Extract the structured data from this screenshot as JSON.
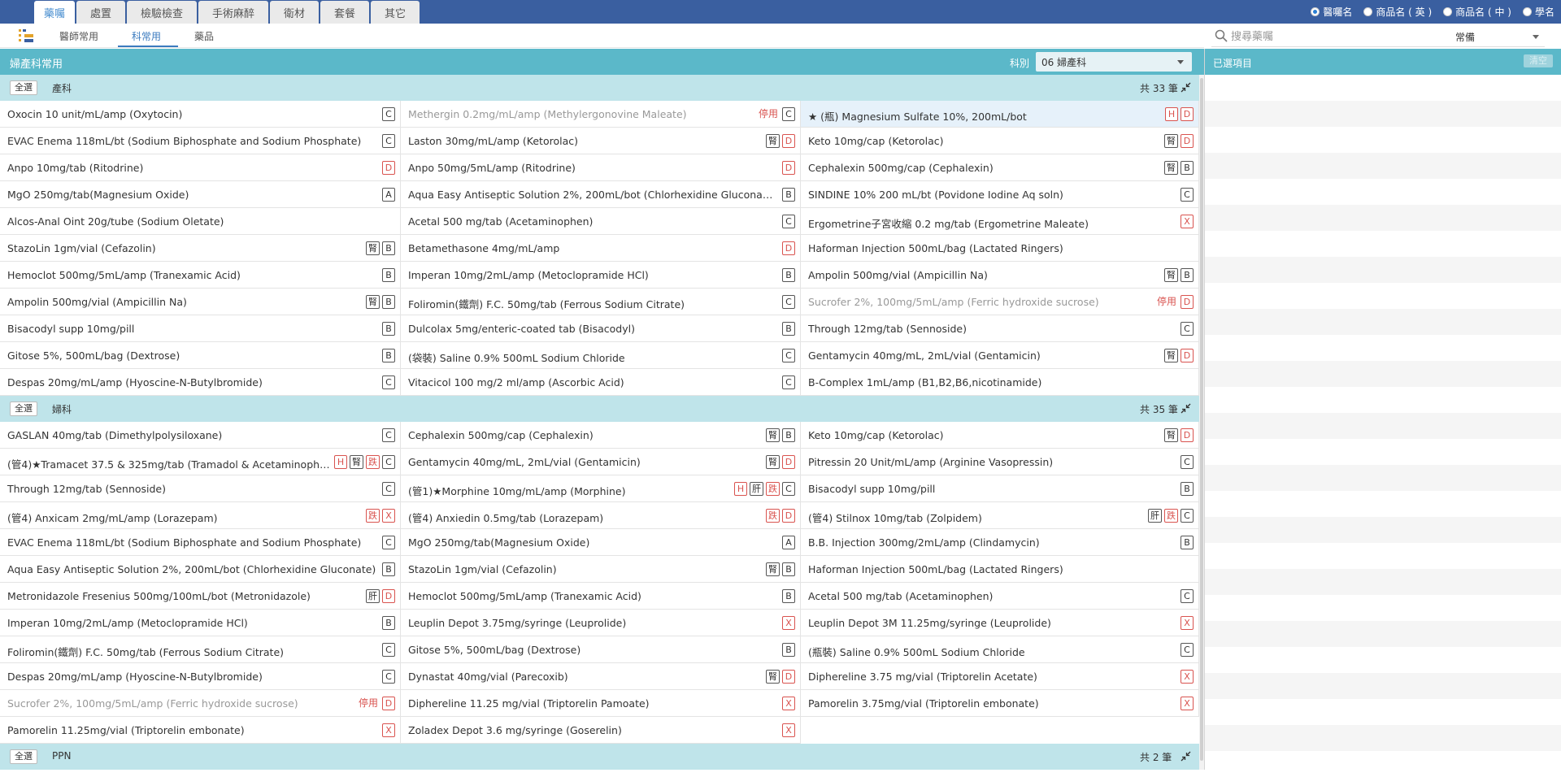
{
  "tabs": [
    {
      "label": "藥囑",
      "active": true
    },
    {
      "label": "處置",
      "active": false
    },
    {
      "label": "檢驗檢查",
      "active": false
    },
    {
      "label": "手術麻醉",
      "active": false
    },
    {
      "label": "衛材",
      "active": false
    },
    {
      "label": "套餐",
      "active": false
    },
    {
      "label": "其它",
      "active": false
    }
  ],
  "name_options": [
    {
      "label": "醫囑名",
      "selected": true
    },
    {
      "label": "商品名 ( 英 )",
      "selected": false
    },
    {
      "label": "商品名 ( 中 )",
      "selected": false
    },
    {
      "label": "學名",
      "selected": false
    }
  ],
  "subtabs": [
    {
      "label": "醫師常用",
      "active": false
    },
    {
      "label": "科常用",
      "active": true
    },
    {
      "label": "藥品",
      "active": false
    }
  ],
  "search": {
    "placeholder": "搜尋藥囑",
    "category": "常備"
  },
  "panel": {
    "title": "婦產科常用",
    "dept_label": "科別",
    "dept_value": "06 婦產科"
  },
  "right_panel": {
    "title": "已選項目",
    "clear_label": "清空"
  },
  "colors": {
    "header": "#5bb8c9",
    "group_header": "#bfe4ea",
    "topbar": "#3a5fa0",
    "badge_red": "#d9534f",
    "accent": "#3b7bbf"
  },
  "groups": [
    {
      "select_all": "全選",
      "name": "產科",
      "count": "共 33 筆",
      "items": [
        {
          "name": "Oxocin 10 unit/mL/amp (Oxytocin)",
          "badges": [
            "C"
          ]
        },
        {
          "name": "Methergin 0.2mg/mL/amp (Methylergonovine Maleate)",
          "disabled": true,
          "stop": "停用",
          "badges": [
            "C"
          ]
        },
        {
          "name": "★ (瓶) Magnesium Sulfate 10%, 200mL/bot",
          "highlight": true,
          "badges": [
            "H",
            "D"
          ]
        },
        {
          "name": "EVAC Enema 118mL/bt (Sodium Biphosphate and Sodium Phosphate)",
          "badges": [
            "C"
          ]
        },
        {
          "name": "Laston 30mg/mL/amp (Ketorolac)",
          "badges": [
            "腎",
            "D"
          ]
        },
        {
          "name": "Keto 10mg/cap (Ketorolac)",
          "badges": [
            "腎",
            "D"
          ]
        },
        {
          "name": "Anpo 10mg/tab (Ritodrine)",
          "badges": [
            "D"
          ]
        },
        {
          "name": "Anpo 50mg/5mL/amp (Ritodrine)",
          "badges": [
            "D"
          ]
        },
        {
          "name": "Cephalexin 500mg/cap (Cephalexin)",
          "badges": [
            "腎",
            "B"
          ]
        },
        {
          "name": "MgO 250mg/tab(Magnesium Oxide)",
          "badges": [
            "A"
          ]
        },
        {
          "name": "Aqua Easy Antiseptic Solution 2%, 200mL/bot (Chlorhexidine Gluconate)",
          "badges": [
            "B"
          ]
        },
        {
          "name": "SINDINE 10% 200 mL/bt (Povidone Iodine Aq soln)",
          "badges": [
            "C"
          ]
        },
        {
          "name": "Alcos-Anal Oint 20g/tube (Sodium Oletate)",
          "badges": []
        },
        {
          "name": "Acetal 500 mg/tab (Acetaminophen)",
          "badges": [
            "C"
          ]
        },
        {
          "name": "Ergometrine子宮收縮 0.2 mg/tab (Ergometrine Maleate)",
          "badges": [
            "X"
          ]
        },
        {
          "name": "StazoLin 1gm/vial (Cefazolin)",
          "badges": [
            "腎",
            "B"
          ]
        },
        {
          "name": "Betamethasone 4mg/mL/amp",
          "badges": [
            "D"
          ]
        },
        {
          "name": "Haforman Injection 500mL/bag (Lactated Ringers)",
          "badges": []
        },
        {
          "name": "Hemoclot 500mg/5mL/amp (Tranexamic Acid)",
          "badges": [
            "B"
          ]
        },
        {
          "name": "Imperan 10mg/2mL/amp (Metoclopramide HCl)",
          "badges": [
            "B"
          ]
        },
        {
          "name": "Ampolin 500mg/vial (Ampicillin Na)",
          "badges": [
            "腎",
            "B"
          ]
        },
        {
          "name": "Ampolin 500mg/vial (Ampicillin Na)",
          "badges": [
            "腎",
            "B"
          ]
        },
        {
          "name": "Foliromin(鐵劑) F.C. 50mg/tab (Ferrous Sodium Citrate)",
          "badges": [
            "C"
          ]
        },
        {
          "name": "Sucrofer 2%, 100mg/5mL/amp (Ferric hydroxide sucrose)",
          "disabled": true,
          "stop": "停用",
          "badges": [
            "D"
          ]
        },
        {
          "name": "Bisacodyl supp 10mg/pill",
          "badges": [
            "B"
          ]
        },
        {
          "name": "Dulcolax 5mg/enteric-coated tab (Bisacodyl)",
          "badges": [
            "B"
          ]
        },
        {
          "name": "Through 12mg/tab (Sennoside)",
          "badges": [
            "C"
          ]
        },
        {
          "name": "Gitose 5%, 500mL/bag (Dextrose)",
          "badges": [
            "B"
          ]
        },
        {
          "name": "(袋裝) Saline 0.9% 500mL Sodium Chloride",
          "badges": [
            "C"
          ]
        },
        {
          "name": "Gentamycin 40mg/mL, 2mL/vial (Gentamicin)",
          "badges": [
            "腎",
            "D"
          ]
        },
        {
          "name": "Despas 20mg/mL/amp (Hyoscine-N-Butylbromide)",
          "badges": [
            "C"
          ]
        },
        {
          "name": "Vitacicol 100 mg/2 ml/amp (Ascorbic Acid)",
          "badges": [
            "C"
          ]
        },
        {
          "name": "B-Complex 1mL/amp (B1,B2,B6,nicotinamide)",
          "badges": []
        }
      ]
    },
    {
      "select_all": "全選",
      "name": "婦科",
      "count": "共 35 筆",
      "items": [
        {
          "name": "GASLAN 40mg/tab (Dimethylpolysiloxane)",
          "badges": [
            "C"
          ]
        },
        {
          "name": "Cephalexin 500mg/cap (Cephalexin)",
          "badges": [
            "腎",
            "B"
          ]
        },
        {
          "name": "Keto 10mg/cap (Ketorolac)",
          "badges": [
            "腎",
            "D"
          ]
        },
        {
          "name": "(管4)★Tramacet 37.5 & 325mg/tab (Tramadol & Acetaminophen)",
          "badges": [
            "H",
            "腎",
            "跌",
            "C"
          ]
        },
        {
          "name": "Gentamycin 40mg/mL, 2mL/vial (Gentamicin)",
          "badges": [
            "腎",
            "D"
          ]
        },
        {
          "name": "Pitressin 20 Unit/mL/amp (Arginine Vasopressin)",
          "badges": [
            "C"
          ]
        },
        {
          "name": "Through 12mg/tab (Sennoside)",
          "badges": [
            "C"
          ]
        },
        {
          "name": "(管1)★Morphine 10mg/mL/amp (Morphine)",
          "badges": [
            "H",
            "肝",
            "跌",
            "C"
          ]
        },
        {
          "name": "Bisacodyl supp 10mg/pill",
          "badges": [
            "B"
          ]
        },
        {
          "name": "(管4) Anxicam 2mg/mL/amp (Lorazepam)",
          "badges": [
            "跌",
            "X"
          ]
        },
        {
          "name": "(管4) Anxiedin 0.5mg/tab (Lorazepam)",
          "badges": [
            "跌",
            "D"
          ]
        },
        {
          "name": "(管4) Stilnox 10mg/tab (Zolpidem)",
          "badges": [
            "肝",
            "跌",
            "C"
          ]
        },
        {
          "name": "EVAC Enema 118mL/bt (Sodium Biphosphate and Sodium Phosphate)",
          "badges": [
            "C"
          ]
        },
        {
          "name": "MgO 250mg/tab(Magnesium Oxide)",
          "badges": [
            "A"
          ]
        },
        {
          "name": "B.B. Injection 300mg/2mL/amp (Clindamycin)",
          "badges": [
            "B"
          ]
        },
        {
          "name": "Aqua Easy Antiseptic Solution 2%, 200mL/bot (Chlorhexidine Gluconate)",
          "badges": [
            "B"
          ]
        },
        {
          "name": "StazoLin 1gm/vial (Cefazolin)",
          "badges": [
            "腎",
            "B"
          ]
        },
        {
          "name": "Haforman Injection 500mL/bag (Lactated Ringers)",
          "badges": []
        },
        {
          "name": "Metronidazole Fresenius 500mg/100mL/bot (Metronidazole)",
          "badges": [
            "肝",
            "D"
          ]
        },
        {
          "name": "Hemoclot 500mg/5mL/amp (Tranexamic Acid)",
          "badges": [
            "B"
          ]
        },
        {
          "name": "Acetal 500 mg/tab (Acetaminophen)",
          "badges": [
            "C"
          ]
        },
        {
          "name": "Imperan 10mg/2mL/amp (Metoclopramide HCl)",
          "badges": [
            "B"
          ]
        },
        {
          "name": "Leuplin Depot 3.75mg/syringe (Leuprolide)",
          "badges": [
            "X"
          ]
        },
        {
          "name": "Leuplin Depot 3M 11.25mg/syringe (Leuprolide)",
          "badges": [
            "X"
          ]
        },
        {
          "name": "Foliromin(鐵劑) F.C. 50mg/tab (Ferrous Sodium Citrate)",
          "badges": [
            "C"
          ]
        },
        {
          "name": "Gitose 5%, 500mL/bag (Dextrose)",
          "badges": [
            "B"
          ]
        },
        {
          "name": "(瓶裝) Saline 0.9% 500mL Sodium Chloride",
          "badges": [
            "C"
          ]
        },
        {
          "name": "Despas 20mg/mL/amp (Hyoscine-N-Butylbromide)",
          "badges": [
            "C"
          ]
        },
        {
          "name": "Dynastat 40mg/vial (Parecoxib)",
          "badges": [
            "腎",
            "D"
          ]
        },
        {
          "name": "Diphereline 3.75 mg/vial (Triptorelin Acetate)",
          "badges": [
            "X"
          ]
        },
        {
          "name": "Sucrofer 2%, 100mg/5mL/amp (Ferric hydroxide sucrose)",
          "disabled": true,
          "stop": "停用",
          "badges": [
            "D"
          ]
        },
        {
          "name": "Diphereline 11.25 mg/vial (Triptorelin Pamoate)",
          "badges": [
            "X"
          ]
        },
        {
          "name": "Pamorelin 3.75mg/vial (Triptorelin embonate)",
          "badges": [
            "X"
          ]
        },
        {
          "name": "Pamorelin 11.25mg/vial (Triptorelin embonate)",
          "badges": [
            "X"
          ]
        },
        {
          "name": "Zoladex Depot 3.6 mg/syringe (Goserelin)",
          "badges": [
            "X"
          ]
        }
      ]
    },
    {
      "select_all": "全選",
      "name": "PPN",
      "count": "共 2 筆",
      "items": []
    }
  ]
}
